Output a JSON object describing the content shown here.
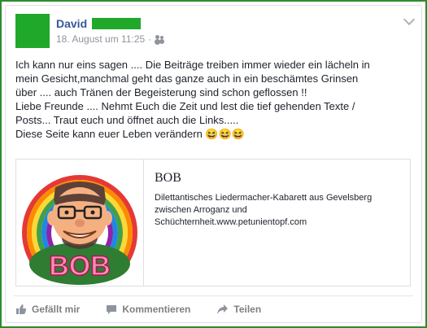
{
  "post": {
    "author": "David",
    "timestamp": "18. August um 11:25",
    "meta_separator": "·",
    "text_lines": [
      "Ich kann nur eins sagen .... Die Beiträge treiben immer wieder ein lächeln in",
      "mein Gesicht,manchmal geht das ganze auch in ein beschämtes Grinsen",
      "über .... auch Tränen der Begeisterung sind schon geflossen !!",
      "Liebe Freunde .... Nehmt Euch die Zeit und lest die tief gehenden Texte /",
      "Posts... Traut euch und öffnet auch die Links.....",
      "Diese Seite kann euer Leben verändern 😆😆😆"
    ]
  },
  "link_card": {
    "title": "BOB",
    "description_lines": [
      "Dilettantisches Liedermacher-Kabarett aus Gevelsberg",
      "zwischen Arroganz und",
      "Schüchternheit.www.petunientopf.com"
    ],
    "logo_text": "BOB"
  },
  "actions": {
    "like": "Gefällt mir",
    "comment": "Kommentieren",
    "share": "Teilen"
  },
  "colors": {
    "frame": "#2e8b2e",
    "author": "#365899",
    "redaction": "#1fa82a"
  }
}
